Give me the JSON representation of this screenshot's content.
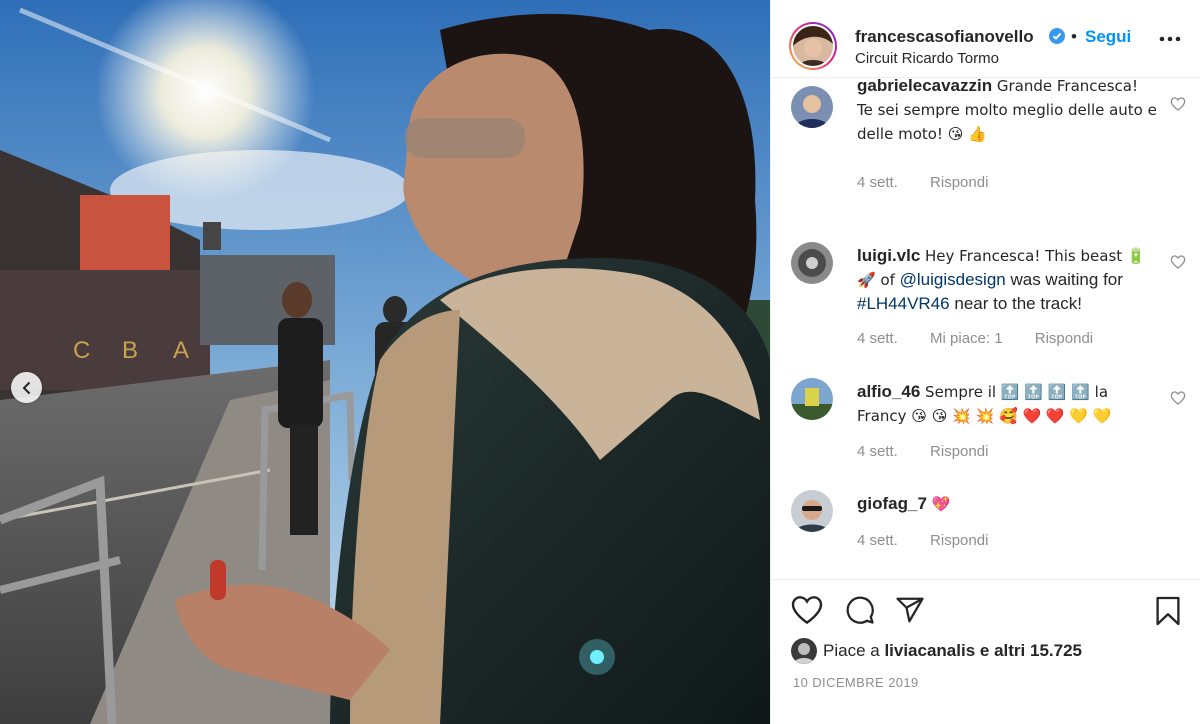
{
  "post": {
    "username": "francescasofianovello",
    "follow_label": "Segui",
    "location": "Circuit Ricardo Tormo",
    "likes_prefix": "Piace a",
    "liked_by": "liviacanalis",
    "likes_suffix": "e altri 15.725",
    "date": "10 DICEMBRE 2019",
    "photo_signs": [
      "C",
      "B",
      "A"
    ]
  },
  "comments": [
    {
      "username": "gabrielecavazzin",
      "text": "Grande Francesca! Te sei sempre molto meglio delle auto e delle moto! 😘 👍",
      "time": "4 sett.",
      "likes": "",
      "reply": "Rispondi"
    },
    {
      "username": "luigi.vlc",
      "text_before": "Hey Francesca! This beast 🔋 🚀  of",
      "mention": "@luigisdesign",
      "text_mid": "was waiting for",
      "hashtag": "#LH44VR46",
      "text_after": "near to the track!",
      "time": "4 sett.",
      "likes": "Mi piace: 1",
      "reply": "Rispondi"
    },
    {
      "username": "alfio_46",
      "text": "Sempre il 🔝 🔝 🔝 🔝 la Francy 😘 😘 💥 💥 🥰 ❤️ ❤️ 💛 💛",
      "time": "4 sett.",
      "likes": "",
      "reply": "Rispondi"
    },
    {
      "username": "giofag_7",
      "text": "💖",
      "time": "4 sett.",
      "likes": "",
      "reply": "Rispondi"
    }
  ],
  "colors": {
    "link": "#00376b",
    "follow": "#0095f6",
    "verified": "#3897f0",
    "meta": "#8e8e8e"
  }
}
